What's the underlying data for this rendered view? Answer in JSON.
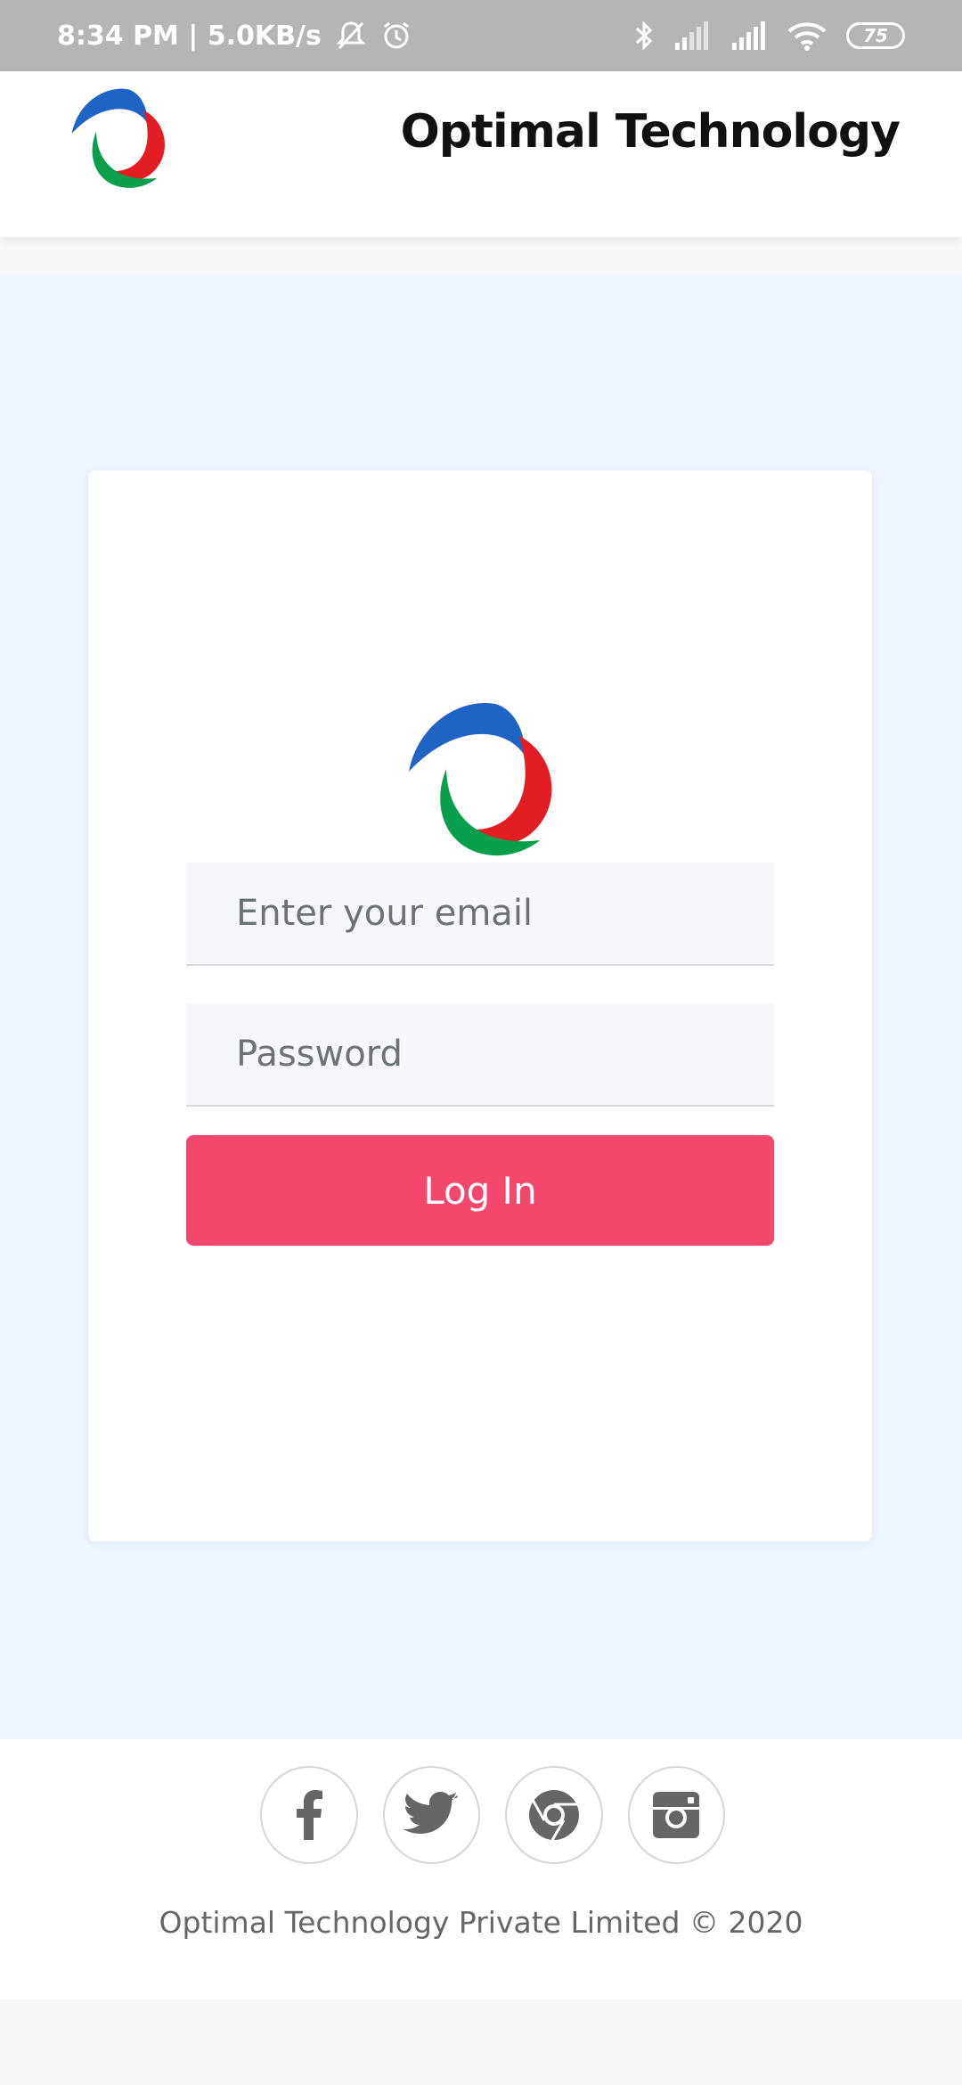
{
  "status_bar": {
    "time_and_speed": "8:34 PM | 5.0KB/s",
    "battery": "75"
  },
  "header": {
    "title": "Optimal Technology"
  },
  "login": {
    "email_placeholder": "Enter your email",
    "password_placeholder": "Password",
    "login_label": "Log In"
  },
  "footer": {
    "social": [
      "facebook-icon",
      "twitter-icon",
      "chrome-icon",
      "instagram-icon"
    ],
    "copyright": "Optimal Technology Private Limited © 2020"
  },
  "colors": {
    "accent": "#f4476e",
    "logo_blue": "#1f63c5",
    "logo_red": "#e21d24",
    "logo_green": "#0a9f4c",
    "background": "#eef4fe"
  }
}
